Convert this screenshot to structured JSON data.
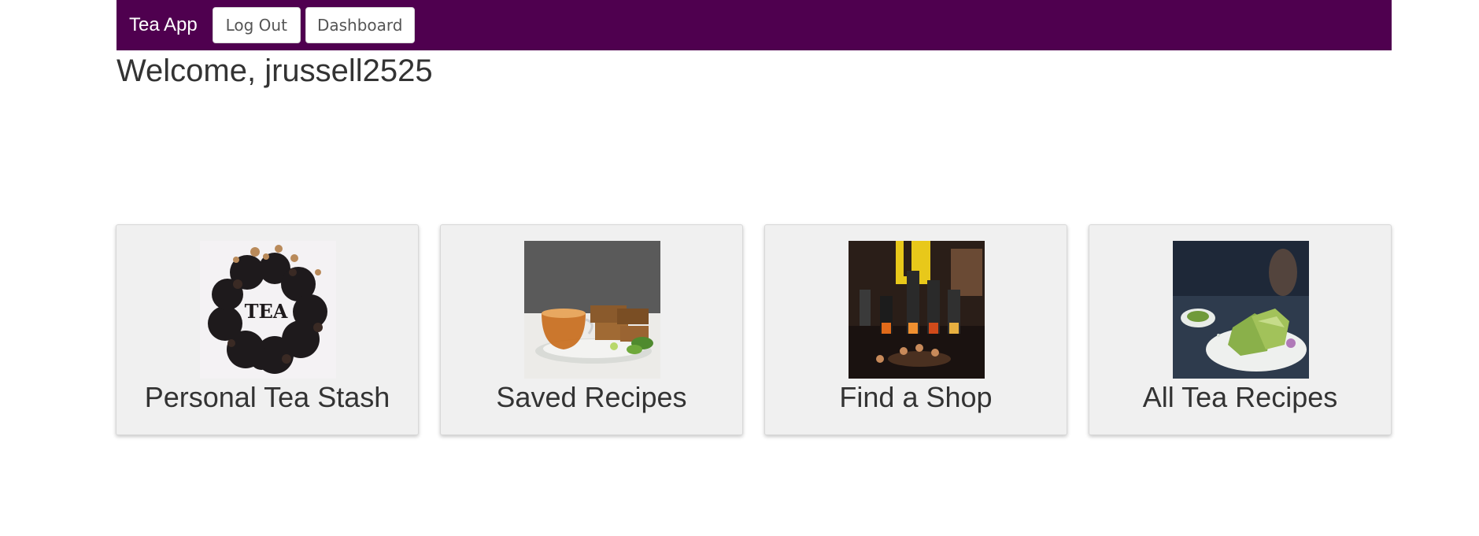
{
  "nav": {
    "brand": "Tea App",
    "logout_label": "Log Out",
    "dashboard_label": "Dashboard",
    "background_color": "#4f004f"
  },
  "welcome": {
    "text": "Welcome, jrussell2525"
  },
  "cards": [
    {
      "title": "Personal Tea Stash",
      "image": "loose-leaf-tea-image"
    },
    {
      "title": "Saved Recipes",
      "image": "tea-cup-and-cake-image"
    },
    {
      "title": "Find a Shop",
      "image": "tea-shop-counter-image"
    },
    {
      "title": "All Tea Recipes",
      "image": "matcha-dessert-image"
    }
  ]
}
